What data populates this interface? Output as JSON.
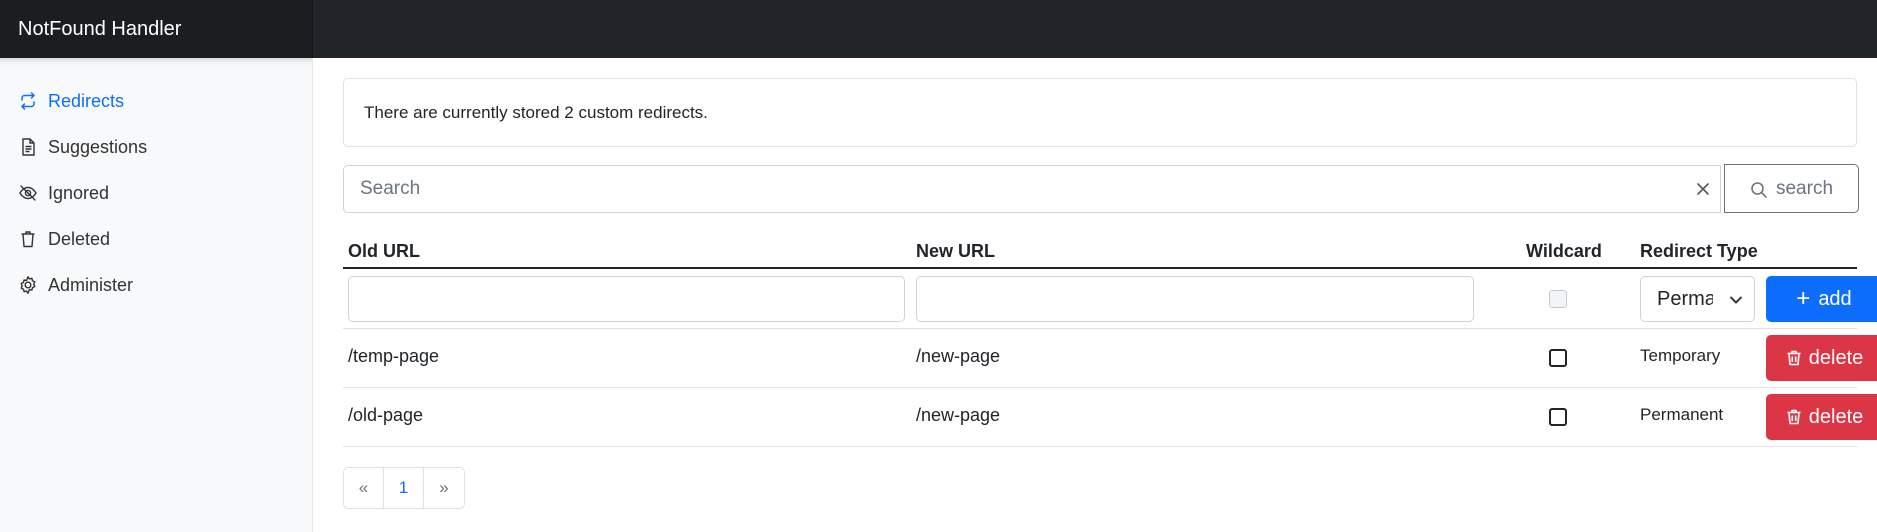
{
  "app": {
    "title": "NotFound Handler"
  },
  "sidebar": {
    "items": [
      {
        "label": "Redirects",
        "icon": "arrows-repeat-icon",
        "active": true
      },
      {
        "label": "Suggestions",
        "icon": "file-text-icon",
        "active": false
      },
      {
        "label": "Ignored",
        "icon": "eye-slash-icon",
        "active": false
      },
      {
        "label": "Deleted",
        "icon": "trash-icon",
        "active": false
      },
      {
        "label": "Administer",
        "icon": "gear-icon",
        "active": false
      }
    ]
  },
  "info": {
    "text": "There are currently stored 2 custom redirects."
  },
  "search": {
    "placeholder": "Search",
    "value": "",
    "button_label": "search"
  },
  "table": {
    "headers": {
      "old_url": "Old URL",
      "new_url": "New URL",
      "wildcard": "Wildcard",
      "redirect_type": "Redirect Type"
    },
    "new_row": {
      "old_url": "",
      "new_url": "",
      "wildcard": false,
      "redirect_type": "Permanent",
      "add_label": "add"
    },
    "rows": [
      {
        "old_url": "/temp-page",
        "new_url": "/new-page",
        "wildcard": false,
        "redirect_type": "Temporary",
        "delete_label": "delete"
      },
      {
        "old_url": "/old-page",
        "new_url": "/new-page",
        "wildcard": false,
        "redirect_type": "Permanent",
        "delete_label": "delete"
      }
    ]
  },
  "pagination": {
    "prev": "«",
    "current": "1",
    "next": "»"
  },
  "colors": {
    "accent": "#0d6efd",
    "danger": "#dc3545",
    "topbar": "#212529"
  }
}
